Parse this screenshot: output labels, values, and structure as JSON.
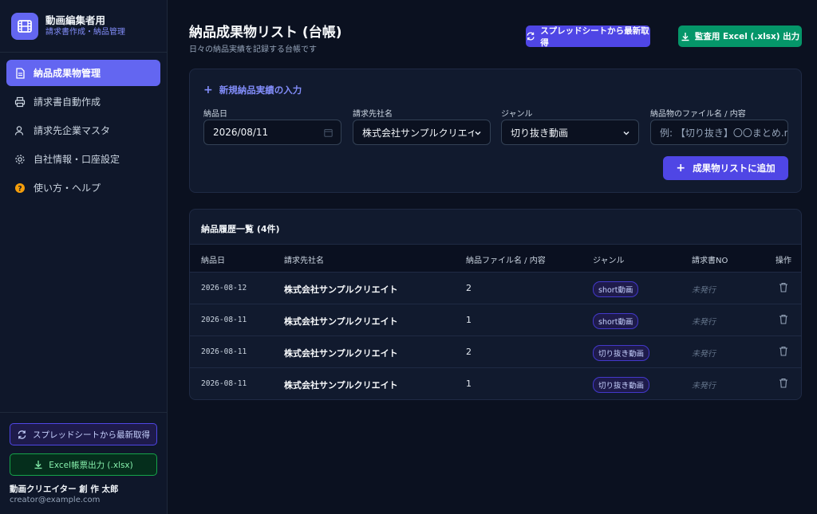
{
  "brand": {
    "title": "動画編集者用",
    "subtitle": "請求書作成・納品管理"
  },
  "nav": [
    {
      "label": "納品成果物管理",
      "icon": "document-icon",
      "active": true
    },
    {
      "label": "請求書自動作成",
      "icon": "printer-icon",
      "active": false
    },
    {
      "label": "請求先企業マスタ",
      "icon": "user-icon",
      "active": false
    },
    {
      "label": "自社情報・口座設定",
      "icon": "gear-icon",
      "active": false
    },
    {
      "label": "使い方・ヘルプ",
      "icon": "help-icon",
      "active": false
    }
  ],
  "sidebar_bottom": {
    "sync_label": "スプレッドシートから最新取得",
    "excel_label": "Excel帳票出力 (.xlsx)",
    "user_name": "動画クリエイター 創 作 太郎",
    "user_email": "creator@example.com"
  },
  "header": {
    "title": "納品成果物リスト (台帳)",
    "subtitle": "日々の納品実績を記録する台帳です",
    "sync_label": "スプレッドシートから最新取得",
    "export_label": "監査用 Excel (.xlsx) 出力"
  },
  "form": {
    "heading": "新規納品実績の入力",
    "date_label": "納品日",
    "date_value": "2026/08/11",
    "client_label": "請求先社名",
    "client_value": "株式会社サンプルクリエイ",
    "genre_label": "ジャンル",
    "genre_value": "切り抜き動画",
    "content_label": "納品物のファイル名 / 内容",
    "content_placeholder": "例: 【切り抜き】〇〇まとめ.r",
    "add_label": "成果物リストに追加"
  },
  "table": {
    "title": "納品履歴一覧 (4件)",
    "headers": {
      "date": "納品日",
      "client": "請求先社名",
      "content": "納品ファイル名 / 内容",
      "genre": "ジャンル",
      "invoice": "請求書NO",
      "action": "操作"
    },
    "rows": [
      {
        "date": "2026-08-12",
        "client": "株式会社サンプルクリエイト",
        "content": "2",
        "genre": "short動画",
        "invoice": "未発行"
      },
      {
        "date": "2026-08-11",
        "client": "株式会社サンプルクリエイト",
        "content": "1",
        "genre": "short動画",
        "invoice": "未発行"
      },
      {
        "date": "2026-08-11",
        "client": "株式会社サンプルクリエイト",
        "content": "2",
        "genre": "切り抜き動画",
        "invoice": "未発行"
      },
      {
        "date": "2026-08-11",
        "client": "株式会社サンプルクリエイト",
        "content": "1",
        "genre": "切り抜き動画",
        "invoice": "未発行"
      }
    ]
  },
  "colors": {
    "accent": "#6366f1",
    "export": "#059669",
    "background": "#0b1120"
  }
}
